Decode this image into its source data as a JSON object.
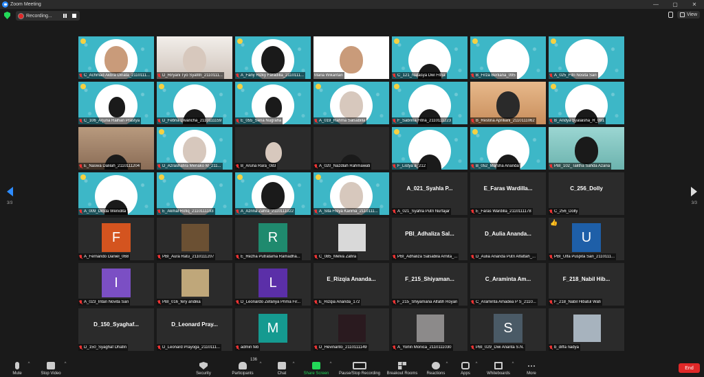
{
  "window": {
    "title": "Zoom Meeting"
  },
  "topbar": {
    "recording_label": "Recording...",
    "view_label": "View"
  },
  "pager": {
    "left_page": "3/3",
    "right_page": "3/3"
  },
  "tiles": [
    {
      "name": "C_Achmad Akbra Dinata_2110111...",
      "bg": "cyan",
      "kind": "face",
      "face": "skin",
      "badge": true
    },
    {
      "name": "D_Riryani Tyo Syafitri_2110111...",
      "bg": "room2",
      "kind": "face",
      "face": "hijab"
    },
    {
      "name": "A_Fany Rizky Faradilla_2110111...",
      "bg": "cyan",
      "kind": "face",
      "face": "hair",
      "badge": true
    },
    {
      "name": "Maria Wikantari",
      "bg": "slide",
      "kind": "face",
      "face": "skin",
      "muted": false
    },
    {
      "name": "C_121_Natasya Dwi Fitria",
      "bg": "cyan",
      "kind": "face",
      "face": "hair-partial",
      "badge": true
    },
    {
      "name": "B_Firza Berliana_095",
      "bg": "cyan",
      "kind": "none",
      "badge": true
    },
    {
      "name": "A_025_Fitri Nosita Sari",
      "bg": "cyan",
      "kind": "none",
      "badge": true
    },
    {
      "name": "C_106_Arjuna Raihan Prastya",
      "bg": "cyan",
      "kind": "face",
      "face": "hair-sm",
      "badge": true
    },
    {
      "name": "D_Febria Divancha_2110111159",
      "bg": "cyan",
      "kind": "face",
      "face": "hair-partial",
      "badge": true
    },
    {
      "name": "E_055_Sena Nugraha",
      "bg": "cyan",
      "kind": "face",
      "face": "hair-sm",
      "badge": true
    },
    {
      "name": "A_019_Rahma Salsabilla",
      "bg": "cyan",
      "kind": "face",
      "face": "hijab",
      "badge": true
    },
    {
      "name": "F_Sabrina Fitria_2110111223",
      "bg": "cyan",
      "kind": "face",
      "face": "hair-partial",
      "badge": true
    },
    {
      "name": "B_Restina Apriliani_2110111062",
      "bg": "orange",
      "kind": "face",
      "face": "hijab-dark"
    },
    {
      "name": "B_Andya Syalaisha_R_091",
      "bg": "cyan",
      "kind": "face",
      "face": "hair-partial",
      "badge": true
    },
    {
      "name": "E_Naswa Dalilah_2110111204",
      "bg": "room",
      "kind": "face",
      "face": "hair-partial"
    },
    {
      "name": "D_Azrashafira Menako M_211...",
      "bg": "cyan",
      "kind": "face",
      "face": "hijab",
      "badge": true
    },
    {
      "name": "B_Aruna Rara_083",
      "bg": "dark",
      "kind": "face",
      "face": "hijab-sm"
    },
    {
      "name": "A_020_Nazdlah Rahmawati",
      "bg": "dark",
      "kind": "face",
      "face": "hair-partial"
    },
    {
      "name": "F_Listya a_212",
      "bg": "cyan",
      "kind": "face",
      "face": "hair-partial",
      "badge": true
    },
    {
      "name": "B_052_Marsha Ananda",
      "bg": "cyan",
      "kind": "face",
      "face": "hair-partial",
      "badge": true
    },
    {
      "name": "PBI_102_Talitha Sahda Azaria",
      "bg": "teal2",
      "kind": "face",
      "face": "hair"
    },
    {
      "name": "A_009_Dinda Wenidita",
      "bg": "cyan",
      "kind": "face",
      "face": "hair-partial",
      "badge": true
    },
    {
      "name": "E_Akmal Rofiq_2110111193",
      "bg": "cyan",
      "kind": "none",
      "badge": true
    },
    {
      "name": "A_Azrina Zahra_2110111022",
      "bg": "cyan",
      "kind": "face",
      "face": "hair",
      "badge": true
    },
    {
      "name": "A_Sita Freya Karima_2110111...",
      "bg": "cyan",
      "kind": "face",
      "face": "hijab",
      "badge": true
    },
    {
      "name": "A_021_Syahla Putri Nurfajar",
      "bg": "dark",
      "kind": "text",
      "big": "A_021_Syahla P..."
    },
    {
      "name": "E_Faras Wardilla_2110111178",
      "bg": "dark",
      "kind": "text",
      "big": "E_Faras Wardilla..."
    },
    {
      "name": "C_256_Dolly",
      "bg": "dark",
      "kind": "text",
      "big": "C_256_Dolly"
    },
    {
      "name": "A_Fernando Daniel_068",
      "bg": "dark",
      "kind": "avatar",
      "letter": "F",
      "color": "#d4541f"
    },
    {
      "name": "PBI_Aura Ratu_2110111207",
      "bg": "dark",
      "kind": "photo",
      "color": "#6b5033"
    },
    {
      "name": "E_Rezha Putratama Ramadha...",
      "bg": "dark",
      "kind": "avatar",
      "letter": "R",
      "color": "#1f8a6e"
    },
    {
      "name": "C_085_Melva Zafira",
      "bg": "dark",
      "kind": "photo",
      "color": "#d9d9d9"
    },
    {
      "name": "PBI_Adhaliza Salsabila Arnita_...",
      "bg": "dark",
      "kind": "text",
      "big": "PBI_Adhaliza Sal..."
    },
    {
      "name": "D_Aulia Ananda Putri Alfattah_...",
      "bg": "dark",
      "kind": "text",
      "big": "D_Aulia Ananda..."
    },
    {
      "name": "PBI_Ulfa Puspita Sari_2110111...",
      "bg": "dark",
      "kind": "avatar",
      "letter": "U",
      "color": "#1e5fa8",
      "thumbs": true
    },
    {
      "name": "A_023_Intan Novita Sari",
      "bg": "dark",
      "kind": "avatar",
      "letter": "I",
      "color": "#7b4fc4"
    },
    {
      "name": "PBI_016_fery andika",
      "bg": "dark",
      "kind": "photo",
      "color": "#bfa77a"
    },
    {
      "name": "D_Leonardo Zefanya Prima Fir...",
      "bg": "dark",
      "kind": "avatar",
      "letter": "L",
      "color": "#5b2fa8"
    },
    {
      "name": "E_Rizqia Ananda_172",
      "bg": "dark",
      "kind": "text",
      "big": "E_Rizqia Ananda..."
    },
    {
      "name": "F_215_Shiyamana Alfatih Royan",
      "bg": "dark",
      "kind": "text",
      "big": "F_215_Shiyaman..."
    },
    {
      "name": "C_Araminta Amadea P S_2110...",
      "bg": "dark",
      "kind": "text",
      "big": "C_Araminta Am..."
    },
    {
      "name": "F_218_Nabil Hibatul Wafi",
      "bg": "dark",
      "kind": "text",
      "big": "F_218_Nabil Hib..."
    },
    {
      "name": "D_150_Syaghaf Dhafin",
      "bg": "dark",
      "kind": "text",
      "big": "D_150_Syaghaf..."
    },
    {
      "name": "D_Leonard Prayoga_2110111...",
      "bg": "dark",
      "kind": "text",
      "big": "D_Leonard Pray..."
    },
    {
      "name": "admin feb",
      "bg": "dark",
      "kind": "avatar",
      "letter": "M",
      "color": "#159a90"
    },
    {
      "name": "D_Hevinanto_2110111149",
      "bg": "dark",
      "kind": "photo",
      "color": "#2a1a1f"
    },
    {
      "name": "A_Yorlin Monica_2110111030",
      "bg": "dark",
      "kind": "photo",
      "color": "#8c8a8a"
    },
    {
      "name": "PBI_029_Dwi Ananta S.N.",
      "bg": "dark",
      "kind": "avatar",
      "letter": "S",
      "color": "#4a5a66"
    },
    {
      "name": "b_diffa nadya",
      "bg": "dark",
      "kind": "photo",
      "color": "#a7b3be"
    }
  ],
  "toolbar": {
    "mute": "Mute",
    "stop_video": "Stop Video",
    "security": "Security",
    "participants": "Participants",
    "participants_count": "136",
    "chat": "Chat",
    "share_screen": "Share Screen",
    "record": "Pause/Stop Recording",
    "breakout": "Breakout Rooms",
    "reactions": "Reactions",
    "apps": "Apps",
    "whiteboards": "Whiteboards",
    "more": "More",
    "end": "End"
  }
}
